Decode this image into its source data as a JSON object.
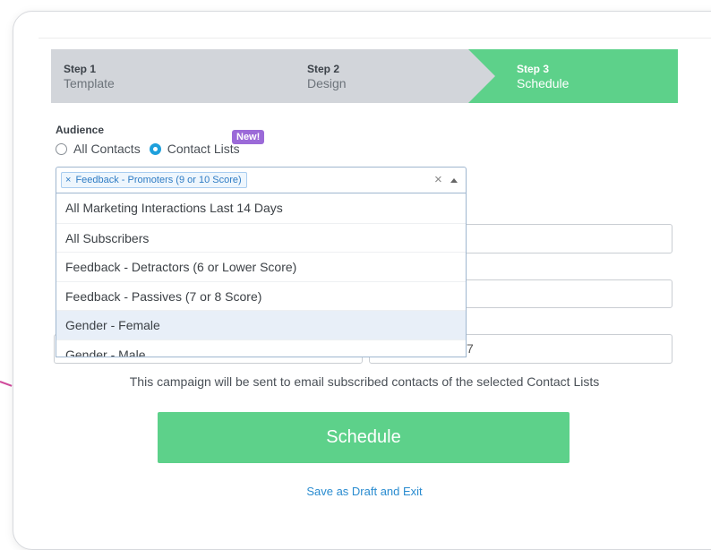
{
  "stepper": {
    "steps": [
      {
        "number": "Step 1",
        "name": "Template",
        "state": "completed"
      },
      {
        "number": "Step 2",
        "name": "Design",
        "state": "completed"
      },
      {
        "number": "Step 3",
        "name": "Schedule",
        "state": "active"
      }
    ]
  },
  "audience": {
    "label": "Audience",
    "options": [
      {
        "label": "All Contacts",
        "selected": false
      },
      {
        "label": "Contact Lists",
        "selected": true
      }
    ],
    "new_badge": "New!"
  },
  "contact_select": {
    "selected_tags": [
      "Feedback - Promoters (9 or 10 Score)"
    ],
    "tag_remove_icon": "×",
    "clear_icon": "×",
    "dropdown_options": [
      "All Marketing Interactions Last 14 Days",
      "All Subscribers",
      "Feedback - Detractors (6 or Lower Score)",
      "Feedback - Passives (7 or 8 Score)",
      "Gender - Female",
      "Gender - Male"
    ],
    "highlighted_option": "Gender - Female"
  },
  "fields": {
    "partial_value": "7"
  },
  "info_text": "This campaign will be sent to email subscribed contacts of the selected Contact Lists",
  "schedule_button": "Schedule",
  "save_draft_link": "Save as Draft and Exit",
  "colors": {
    "accent_green": "#5dd18a",
    "step_inactive": "#d2d5da",
    "radio_blue": "#1ea0dc",
    "badge_purple": "#9b6ad8",
    "link_blue": "#2a8cd0"
  }
}
